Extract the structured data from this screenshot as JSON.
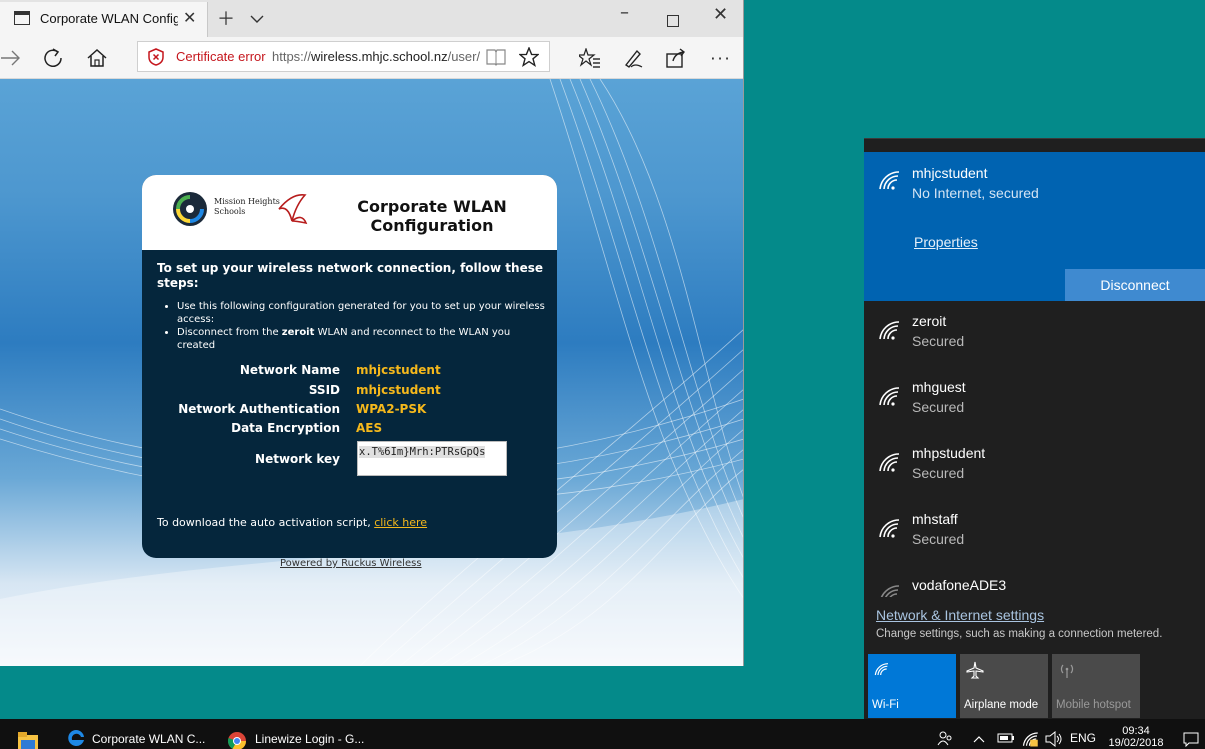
{
  "browser": {
    "tab_title": "Corporate WLAN Configuration",
    "certificate_error": "Certificate error",
    "url_scheme": "https://",
    "url_host": "wireless.mhjc.school.nz",
    "url_path": "/user/",
    "title_bar_icons": [
      "new-tab-icon",
      "tab-list-icon",
      "minimize-icon",
      "maximize-icon",
      "close-icon"
    ],
    "nav_icons": [
      "forward-icon",
      "refresh-icon",
      "home-icon",
      "reading-view-icon",
      "favorite-icon",
      "favorites-hub-icon",
      "pen-icon",
      "share-icon",
      "more-icon"
    ]
  },
  "page": {
    "logo_text": "Mission Heights Schools",
    "title": "Corporate WLAN Configuration",
    "intro": "To set up your wireless network connection, follow these steps:",
    "bullet1": "Use this following configuration generated for you to set up your wireless access:",
    "bullet2_pre": "Disconnect from the ",
    "bullet2_bold": "zeroit",
    "bullet2_post": " WLAN and reconnect to the WLAN you created",
    "config": [
      {
        "key": "Network Name",
        "value": "mhjcstudent"
      },
      {
        "key": "SSID",
        "value": "mhjcstudent"
      },
      {
        "key": "Network Authentication",
        "value": "WPA2-PSK"
      },
      {
        "key": "Data Encryption",
        "value": "AES"
      }
    ],
    "network_key_label": "Network key",
    "network_key_value": "x.T%6Im}Mrh:PTRsGpQs",
    "download_text": "To download the auto activation script, ",
    "download_link": "click here",
    "powered_by": "Powered by Ruckus Wireless"
  },
  "flyout": {
    "active": {
      "name": "mhjcstudent",
      "status": "No Internet, secured",
      "properties": "Properties",
      "disconnect": "Disconnect"
    },
    "networks": [
      {
        "name": "zeroit",
        "status": "Secured"
      },
      {
        "name": "mhguest",
        "status": "Secured"
      },
      {
        "name": "mhpstudent",
        "status": "Secured"
      },
      {
        "name": "mhstaff",
        "status": "Secured"
      },
      {
        "name": "vodafoneADE3",
        "status": ""
      }
    ],
    "settings_link": "Network & Internet settings",
    "settings_desc": "Change settings, such as making a connection metered.",
    "quick_actions": [
      {
        "label": "Wi-Fi",
        "active": true,
        "color": "#0078d7"
      },
      {
        "label": "Airplane mode",
        "active": false,
        "color": "#4a4a4a"
      },
      {
        "label": "Mobile hotspot",
        "active": false,
        "color": "#4a4a4a"
      }
    ]
  },
  "taskbar": {
    "apps": [
      {
        "label": "Corporate WLAN C..."
      },
      {
        "label": "Linewize Login - G..."
      }
    ],
    "lang": "ENG",
    "time": "09:34",
    "date": "19/02/2018"
  },
  "colors": {
    "accent": "#0063b1",
    "link_gold": "#f5b81c",
    "card_bg": "#05263c",
    "cert_red": "#c5161d",
    "desktop": "#048a8a"
  }
}
